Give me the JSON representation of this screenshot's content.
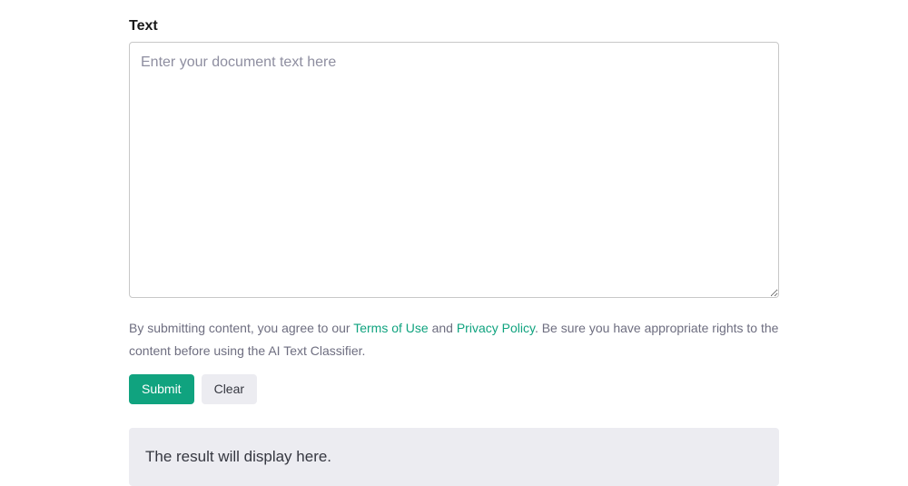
{
  "form": {
    "label": "Text",
    "placeholder": "Enter your document text here",
    "value": ""
  },
  "disclaimer": {
    "prefix": "By submitting content, you agree to our ",
    "terms_link": "Terms of Use",
    "middle": " and ",
    "privacy_link": "Privacy Policy",
    "suffix": ". Be sure you have appropriate rights to the content before using the AI Text Classifier."
  },
  "buttons": {
    "submit": "Submit",
    "clear": "Clear"
  },
  "result": {
    "placeholder_text": "The result will display here."
  }
}
